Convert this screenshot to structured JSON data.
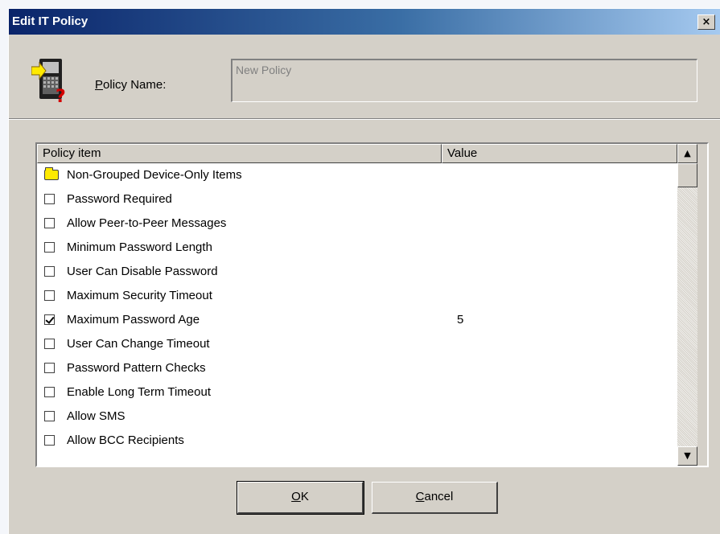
{
  "window": {
    "title": "Edit IT Policy",
    "close_glyph": "×"
  },
  "form": {
    "name_label_accel": "P",
    "name_label_rest": "olicy Name:",
    "name_value": "New Policy"
  },
  "list": {
    "columns": [
      "Policy item",
      "Value"
    ],
    "rows": [
      {
        "type": "folder",
        "label": "Non-Grouped Device-Only Items",
        "value": ""
      },
      {
        "type": "checkbox",
        "checked": false,
        "label": "Password Required",
        "value": ""
      },
      {
        "type": "checkbox",
        "checked": false,
        "label": "Allow Peer-to-Peer Messages",
        "value": ""
      },
      {
        "type": "checkbox",
        "checked": false,
        "label": "Minimum Password Length",
        "value": ""
      },
      {
        "type": "checkbox",
        "checked": false,
        "label": "User Can Disable Password",
        "value": ""
      },
      {
        "type": "checkbox",
        "checked": false,
        "label": "Maximum Security Timeout",
        "value": ""
      },
      {
        "type": "checkbox",
        "checked": true,
        "label": "Maximum Password Age",
        "value": "5"
      },
      {
        "type": "checkbox",
        "checked": false,
        "label": "User Can Change Timeout",
        "value": ""
      },
      {
        "type": "checkbox",
        "checked": false,
        "label": "Password Pattern Checks",
        "value": ""
      },
      {
        "type": "checkbox",
        "checked": false,
        "label": "Enable Long Term Timeout",
        "value": ""
      },
      {
        "type": "checkbox",
        "checked": false,
        "label": "Allow SMS",
        "value": ""
      },
      {
        "type": "checkbox",
        "checked": false,
        "label": "Allow BCC Recipients",
        "value": ""
      }
    ],
    "scroll_up_glyph": "▲",
    "scroll_down_glyph": "▼"
  },
  "buttons": {
    "ok_accel": "O",
    "ok_rest": "K",
    "cancel_accel": "C",
    "cancel_rest": "ancel"
  },
  "colors": {
    "titlebar_start": "#0a246a",
    "titlebar_end": "#a6caf0",
    "dialog_face": "#d4d0c8",
    "folder": "#ffea00"
  },
  "icons": {
    "policy": "handheld-device-policy-icon",
    "folder": "folder-icon"
  }
}
